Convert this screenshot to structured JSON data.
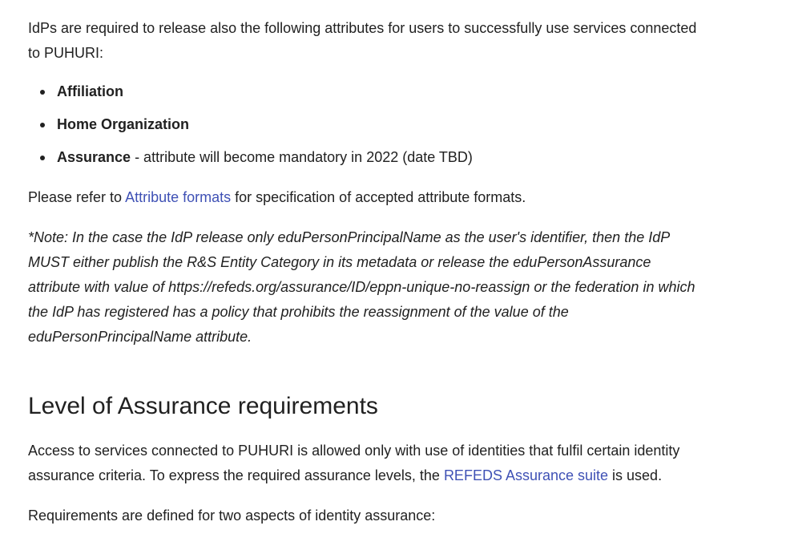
{
  "intro": "IdPs are required to release also the following attributes for users to successfully use services connected to PUHURI:",
  "attributes": [
    {
      "name": "Affiliation",
      "suffix": ""
    },
    {
      "name": "Home Organization",
      "suffix": ""
    },
    {
      "name": "Assurance",
      "suffix": " - attribute will become mandatory in 2022 (date TBD)"
    }
  ],
  "refer": {
    "before": "Please refer to ",
    "link": "Attribute formats",
    "after": " for specification of accepted attribute formats."
  },
  "note": "*Note: In the case the IdP release only eduPersonPrincipalName as the user's identifier, then the IdP MUST either publish the R&S Entity Category in its metadata or release the eduPersonAssurance attribute with value of https://refeds.org/assurance/ID/eppn-unique-no-reassign or the federation in which the IdP has registered has a policy that prohibits the reassignment of the value of the eduPersonPrincipalName attribute.",
  "section_heading": "Level of Assurance requirements",
  "access": {
    "before": "Access to services connected to PUHURI is allowed only with use of identities that fulfil certain identity assurance criteria. To express the required assurance levels, the ",
    "link": "REFEDS Assurance suite",
    "after": " is used."
  },
  "requirements": "Requirements are defined for two aspects of identity assurance:"
}
